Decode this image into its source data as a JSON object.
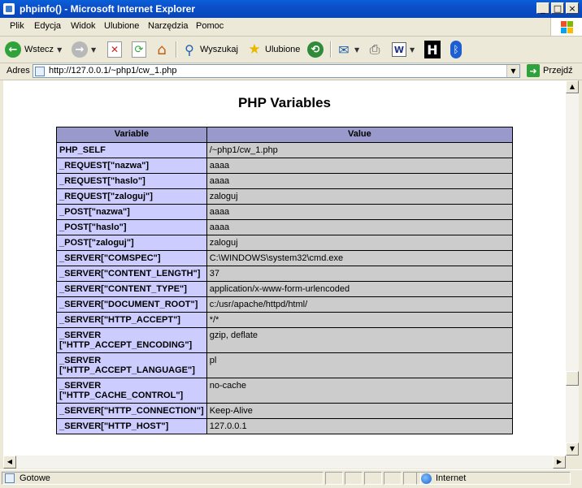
{
  "window": {
    "title": "phpinfo() - Microsoft Internet Explorer"
  },
  "menu": [
    "Plik",
    "Edycja",
    "Widok",
    "Ulubione",
    "Narzędzia",
    "Pomoc"
  ],
  "toolbar": {
    "back_label": "Wstecz",
    "search_label": "Wyszukaj",
    "favorites_label": "Ulubione"
  },
  "address": {
    "label": "Adres",
    "url": "http://127.0.0.1/~php1/cw_1.php",
    "go_label": "Przejdź"
  },
  "page": {
    "title": "PHP Variables",
    "columns": [
      "Variable",
      "Value"
    ],
    "rows": [
      {
        "name": "PHP_SELF",
        "value": "/~php1/cw_1.php"
      },
      {
        "name": "_REQUEST[\"nazwa\"]",
        "value": "aaaa"
      },
      {
        "name": "_REQUEST[\"haslo\"]",
        "value": "aaaa"
      },
      {
        "name": "_REQUEST[\"zaloguj\"]",
        "value": "zaloguj"
      },
      {
        "name": "_POST[\"nazwa\"]",
        "value": "aaaa"
      },
      {
        "name": "_POST[\"haslo\"]",
        "value": "aaaa"
      },
      {
        "name": "_POST[\"zaloguj\"]",
        "value": "zaloguj"
      },
      {
        "name": "_SERVER[\"COMSPEC\"]",
        "value": "C:\\WINDOWS\\system32\\cmd.exe"
      },
      {
        "name": "_SERVER[\"CONTENT_LENGTH\"]",
        "value": "37"
      },
      {
        "name": "_SERVER[\"CONTENT_TYPE\"]",
        "value": "application/x-www-form-urlencoded"
      },
      {
        "name": "_SERVER[\"DOCUMENT_ROOT\"]",
        "value": "c:/usr/apache/httpd/html/"
      },
      {
        "name": "_SERVER[\"HTTP_ACCEPT\"]",
        "value": "*/*"
      },
      {
        "name": "_SERVER [\"HTTP_ACCEPT_ENCODING\"]",
        "value": "gzip, deflate"
      },
      {
        "name": "_SERVER [\"HTTP_ACCEPT_LANGUAGE\"]",
        "value": "pl"
      },
      {
        "name": "_SERVER [\"HTTP_CACHE_CONTROL\"]",
        "value": "no-cache"
      },
      {
        "name": "_SERVER[\"HTTP_CONNECTION\"]",
        "value": "Keep-Alive"
      },
      {
        "name": "_SERVER[\"HTTP_HOST\"]",
        "value": "127.0.0.1"
      }
    ]
  },
  "status": {
    "text": "Gotowe",
    "zone": "Internet"
  },
  "icons": {
    "back": "back-arrow-icon",
    "forward": "forward-arrow-icon",
    "stop": "stop-icon",
    "refresh": "refresh-icon",
    "home": "home-icon",
    "search": "search-icon",
    "favorites": "favorites-star-icon",
    "history": "history-icon",
    "mail": "mail-icon",
    "print": "printer-icon",
    "edit": "word-edit-icon",
    "h": "h-toolbar-icon",
    "bluetooth": "bluetooth-icon"
  },
  "colors": {
    "titlebar": "#0A5FD8",
    "header_bg": "#9999CC",
    "name_bg": "#CCCCFF",
    "value_bg": "#CCCCCC"
  }
}
